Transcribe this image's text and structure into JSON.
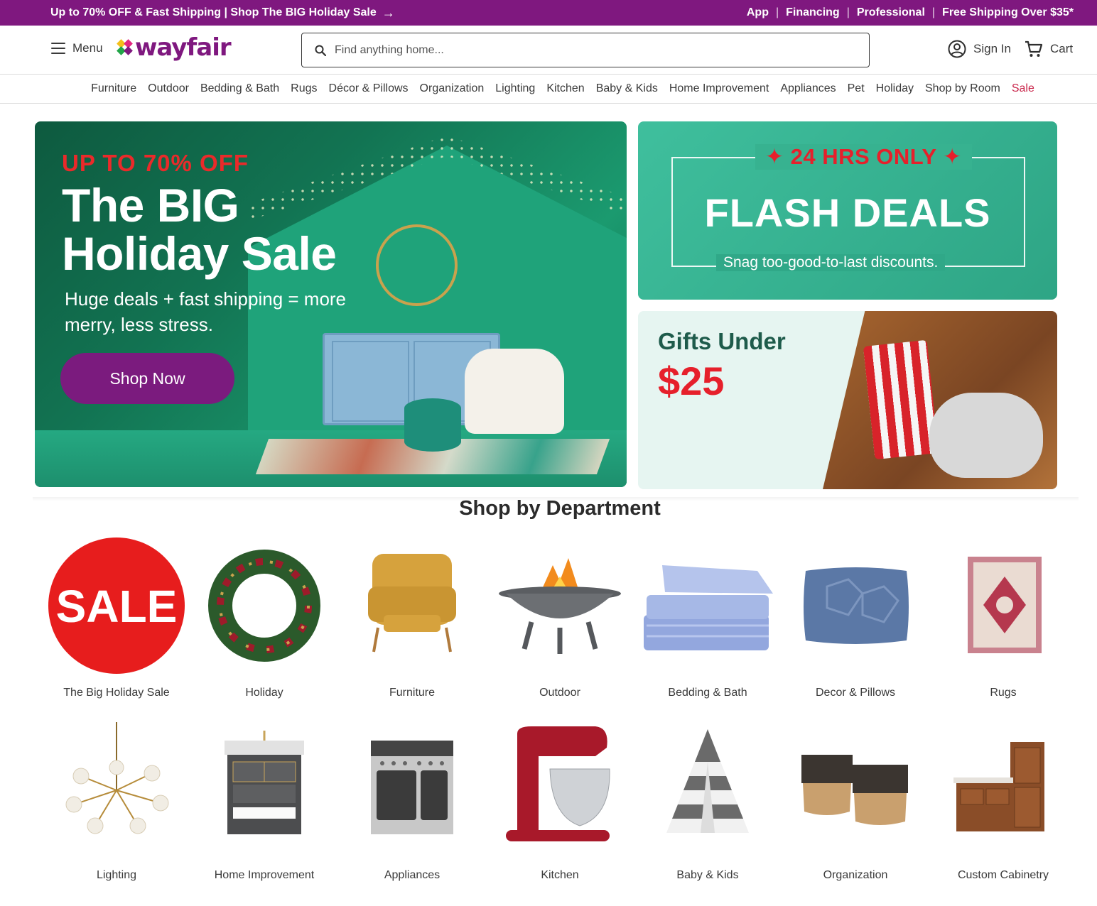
{
  "promo": {
    "left_text": "Up to 70% OFF & Fast Shipping | Shop The BIG Holiday Sale",
    "links": [
      "App",
      "Financing",
      "Professional",
      "Free Shipping Over $35*"
    ]
  },
  "header": {
    "menu_label": "Menu",
    "logo_text": "wayfair",
    "search_placeholder": "Find anything home...",
    "signin_label": "Sign In",
    "cart_label": "Cart"
  },
  "nav": [
    "Furniture",
    "Outdoor",
    "Bedding & Bath",
    "Rugs",
    "Décor & Pillows",
    "Organization",
    "Lighting",
    "Kitchen",
    "Baby & Kids",
    "Home Improvement",
    "Appliances",
    "Pet",
    "Holiday",
    "Shop by Room",
    "Sale"
  ],
  "hero": {
    "kicker": "UP TO 70% OFF",
    "title": "The BIG Holiday Sale",
    "subtitle": "Huge deals + fast shipping = more merry, less stress.",
    "cta": "Shop Now"
  },
  "flash": {
    "badge": "24 HRS ONLY",
    "title": "FLASH DEALS",
    "tagline": "Snag too-good-to-last discounts."
  },
  "gifts": {
    "line1": "Gifts Under",
    "price": "$25"
  },
  "department": {
    "title": "Shop by Department",
    "row1": [
      "The Big Holiday Sale",
      "Holiday",
      "Furniture",
      "Outdoor",
      "Bedding & Bath",
      "Decor & Pillows",
      "Rugs"
    ],
    "row2": [
      "Lighting",
      "Home Improvement",
      "Appliances",
      "Kitchen",
      "Baby & Kids",
      "Organization",
      "Custom Cabinetry"
    ],
    "sale_badge": "SALE"
  },
  "colors": {
    "brand_purple": "#7f187f",
    "sale_red": "#e6202b",
    "flash_green": "#3fbf9d"
  }
}
